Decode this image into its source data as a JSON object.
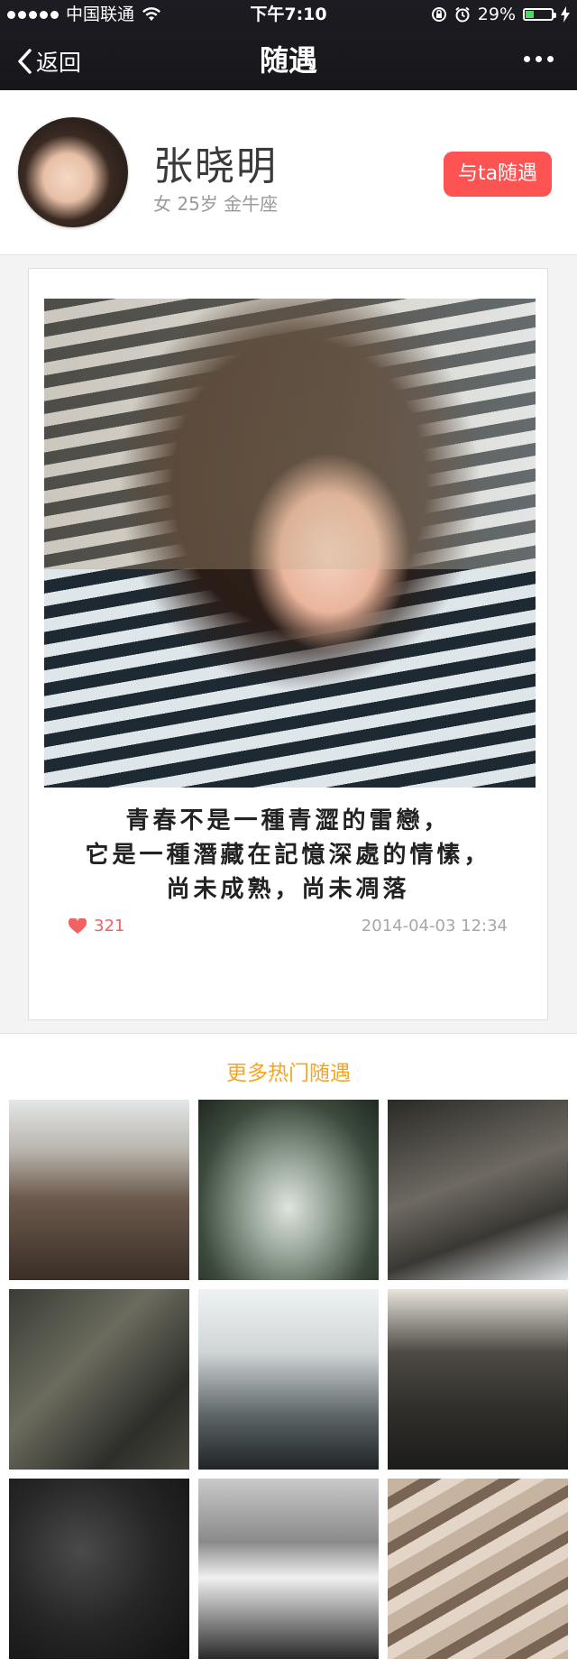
{
  "status_bar": {
    "carrier": "中国联通",
    "time": "下午7:10",
    "battery_percent": "29%",
    "battery_level": 0.29
  },
  "nav": {
    "back_label": "返回",
    "title": "随遇"
  },
  "profile": {
    "name": "张晓明",
    "meta": "女 25岁 金牛座",
    "action_label": "与ta随遇"
  },
  "post": {
    "quote_lines": [
      "青春不是一種青澀的雷戀，",
      "它是一種潛藏在記憶深處的情愫，",
      "尚未成熟，尚未凋落"
    ],
    "likes": "321",
    "date": "2014-04-03 12:34"
  },
  "more": {
    "title": "更多热门随遇",
    "tiles": [
      "mountain-aerial",
      "trees",
      "rocky-coast",
      "dark-rock",
      "ocean-waves",
      "sea-stack",
      "black-rock",
      "stormy-clouds",
      "layered-rock"
    ]
  },
  "colors": {
    "accent": "#fd5352",
    "orange": "#f5a623",
    "nav_bg": "#1c1c22"
  }
}
